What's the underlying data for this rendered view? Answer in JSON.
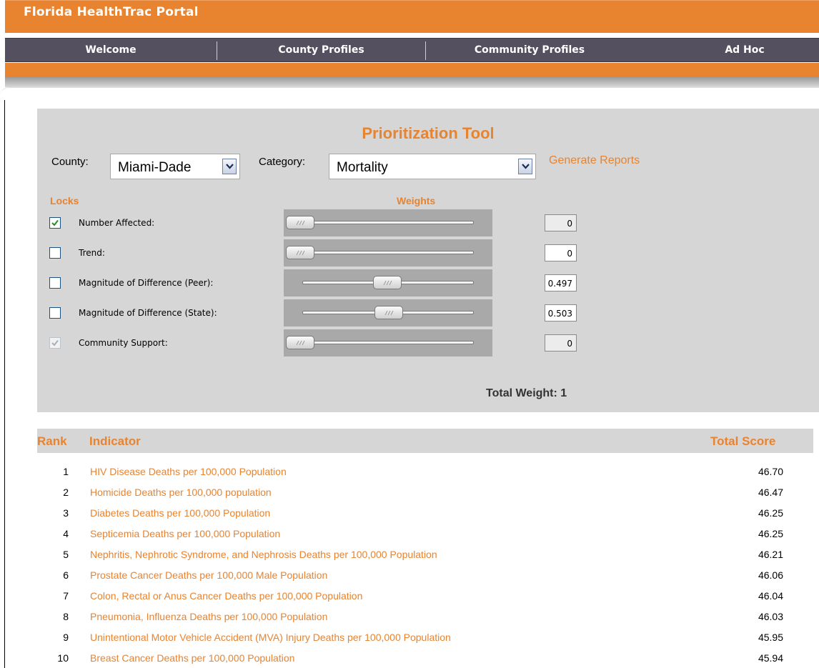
{
  "app": {
    "title": "Florida HealthTrac Portal"
  },
  "nav": {
    "items": [
      {
        "label": "Welcome"
      },
      {
        "label": "County Profiles"
      },
      {
        "label": "Community Profiles"
      },
      {
        "label": "Ad Hoc"
      }
    ]
  },
  "tool": {
    "title": "Prioritization Tool",
    "county_label": "County:",
    "county_value": "Miami-Dade",
    "category_label": "Category:",
    "category_value": "Mortality",
    "generate_link": "Generate Reports",
    "locks_header": "Locks",
    "weights_header": "Weights",
    "rows": [
      {
        "label": "Number Affected:",
        "locked": true,
        "lock_disabled": false,
        "slider_position": 0.0,
        "value": "0",
        "readonly": true
      },
      {
        "label": "Trend:",
        "locked": false,
        "lock_disabled": false,
        "slider_position": 0.0,
        "value": "0",
        "readonly": false
      },
      {
        "label": "Magnitude of Difference (Peer):",
        "locked": false,
        "lock_disabled": false,
        "slider_position": 0.497,
        "value": "0.497",
        "readonly": false
      },
      {
        "label": "Magnitude of Difference (State):",
        "locked": false,
        "lock_disabled": false,
        "slider_position": 0.503,
        "value": "0.503",
        "readonly": false
      },
      {
        "label": "Community Support:",
        "locked": true,
        "lock_disabled": true,
        "slider_position": 0.0,
        "value": "0",
        "readonly": true
      }
    ],
    "total_weight": "Total Weight: 1"
  },
  "results": {
    "headers": {
      "rank": "Rank",
      "indicator": "Indicator",
      "score": "Total Score"
    },
    "rows": [
      {
        "rank": "1",
        "indicator": "HIV Disease Deaths per 100,000 Population",
        "score": "46.70"
      },
      {
        "rank": "2",
        "indicator": "Homicide Deaths per 100,000 population",
        "score": "46.47"
      },
      {
        "rank": "3",
        "indicator": "Diabetes Deaths per 100,000 Population",
        "score": "46.25"
      },
      {
        "rank": "4",
        "indicator": "Septicemia Deaths per 100,000 Population",
        "score": "46.25"
      },
      {
        "rank": "5",
        "indicator": "Nephritis, Nephrotic Syndrome, and Nephrosis Deaths per 100,000 Population",
        "score": "46.21"
      },
      {
        "rank": "6",
        "indicator": "Prostate Cancer Deaths per 100,000 Male Population",
        "score": "46.06"
      },
      {
        "rank": "7",
        "indicator": "Colon, Rectal or Anus Cancer Deaths per 100,000 Population",
        "score": "46.04"
      },
      {
        "rank": "8",
        "indicator": "Pneumonia, Influenza Deaths per 100,000 Population",
        "score": "46.03"
      },
      {
        "rank": "9",
        "indicator": "Unintentional Motor Vehicle Accident (MVA) Injury Deaths per 100,000 Population",
        "score": "45.95"
      },
      {
        "rank": "10",
        "indicator": "Breast Cancer Deaths per 100,000 Population",
        "score": "45.94"
      }
    ]
  },
  "colors": {
    "brand_orange": "#e8832f",
    "nav_dark": "#55505f",
    "panel_gray": "#d6d6d6"
  }
}
